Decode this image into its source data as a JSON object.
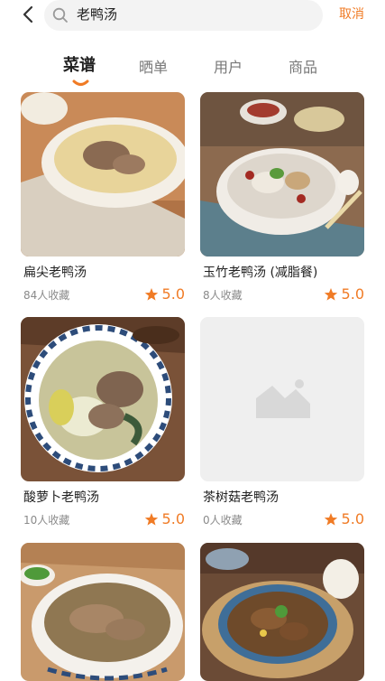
{
  "header": {
    "search_query": "老鸭汤",
    "cancel_label": "取消"
  },
  "tabs": [
    {
      "label": "菜谱",
      "active": true
    },
    {
      "label": "晒单",
      "active": false
    },
    {
      "label": "用户",
      "active": false
    },
    {
      "label": "商品",
      "active": false
    }
  ],
  "colors": {
    "accent": "#f07b25",
    "placeholder": "#efefef"
  },
  "icons": {
    "back": "chevron-left-icon",
    "search": "search-icon",
    "star": "star-icon",
    "placeholder": "image-placeholder-icon"
  },
  "recipes": [
    {
      "title": "扁尖老鸭汤",
      "favorites": "84人收藏",
      "rating": "5.0",
      "image": "photo"
    },
    {
      "title": "玉竹老鸭汤 (减脂餐)",
      "favorites": "8人收藏",
      "rating": "5.0",
      "image": "photo"
    },
    {
      "title": "酸萝卜老鸭汤",
      "favorites": "10人收藏",
      "rating": "5.0",
      "image": "photo"
    },
    {
      "title": "茶树菇老鸭汤",
      "favorites": "0人收藏",
      "rating": "5.0",
      "image": "placeholder"
    },
    {
      "title": "",
      "favorites": "",
      "rating": "",
      "image": "photo"
    },
    {
      "title": "",
      "favorites": "",
      "rating": "",
      "image": "photo"
    }
  ]
}
